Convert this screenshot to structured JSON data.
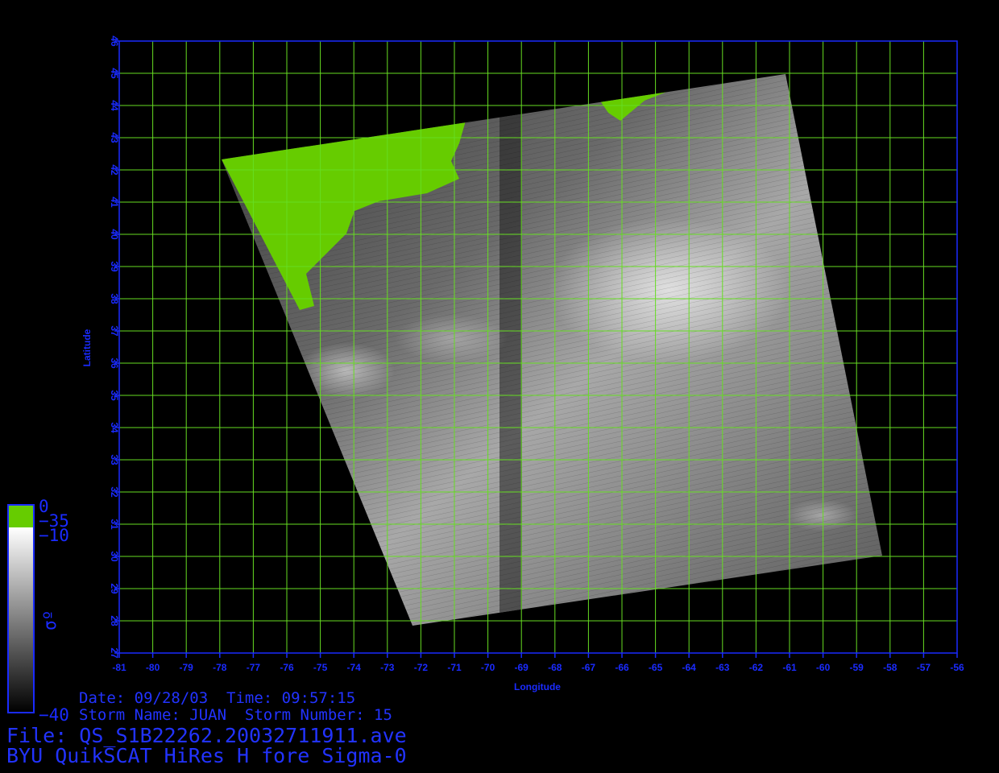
{
  "map": {
    "lon_range": [
      -81,
      -56
    ],
    "lat_range": [
      27,
      46
    ],
    "lon_ticks": [
      "-81",
      "-80",
      "-79",
      "-78",
      "-77",
      "-76",
      "-75",
      "-74",
      "-73",
      "-72",
      "-71",
      "-70",
      "-69",
      "-68",
      "-67",
      "-66",
      "-65",
      "-64",
      "-63",
      "-62",
      "-61",
      "-60",
      "-59",
      "-58",
      "-57",
      "-56"
    ],
    "lat_ticks": [
      "27",
      "28",
      "29",
      "30",
      "31",
      "32",
      "33",
      "34",
      "35",
      "36",
      "37",
      "38",
      "39",
      "40",
      "41",
      "42",
      "43",
      "44",
      "45",
      "46"
    ],
    "xlabel": "Longitude",
    "ylabel": "Latitude",
    "grid": true,
    "colors": {
      "axis": "#1a2bff",
      "grid": "#66dd22",
      "land": "#66cc00",
      "background": "#000000"
    }
  },
  "colorbar": {
    "label_top": "0",
    "label_land": "−35",
    "label_upper": "−10",
    "label_bottom": "−40",
    "symbol": "σº"
  },
  "info": {
    "date_line": "Date: 09/28/03  Time: 09:57:15",
    "storm_line": "Storm Name: JUAN  Storm Number: 15",
    "file_line": "File: QS_S1B22262.20032711911.ave",
    "product_line": "BYU QuikSCAT HiRes H fore Sigma-0"
  }
}
